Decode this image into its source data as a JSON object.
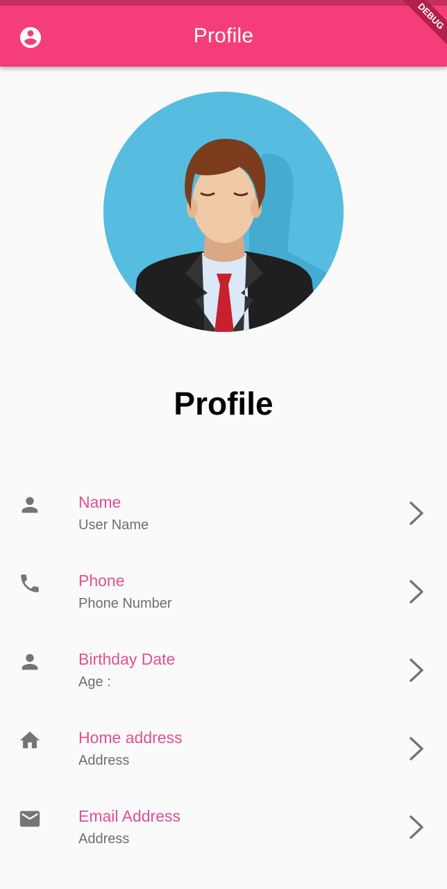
{
  "app_bar": {
    "title": "Profile",
    "leading_icon": "account-circle-icon",
    "debug_banner": "DEBUG",
    "color": "#f53d7a"
  },
  "header": {
    "avatar_alt": "Profile avatar",
    "heading": "Profile"
  },
  "items": [
    {
      "icon": "person-icon",
      "title": "Name",
      "subtitle": "User Name"
    },
    {
      "icon": "phone-icon",
      "title": "Phone",
      "subtitle": "Phone Number"
    },
    {
      "icon": "person-icon",
      "title": "Birthday Date",
      "subtitle": "Age :"
    },
    {
      "icon": "home-icon",
      "title": "Home address",
      "subtitle": "Address"
    },
    {
      "icon": "email-icon",
      "title": "Email Address",
      "subtitle": "Address"
    }
  ],
  "colors": {
    "accent": "#e34f8b",
    "icon_gray": "#757575",
    "avatar_bg": "#56bde0"
  }
}
